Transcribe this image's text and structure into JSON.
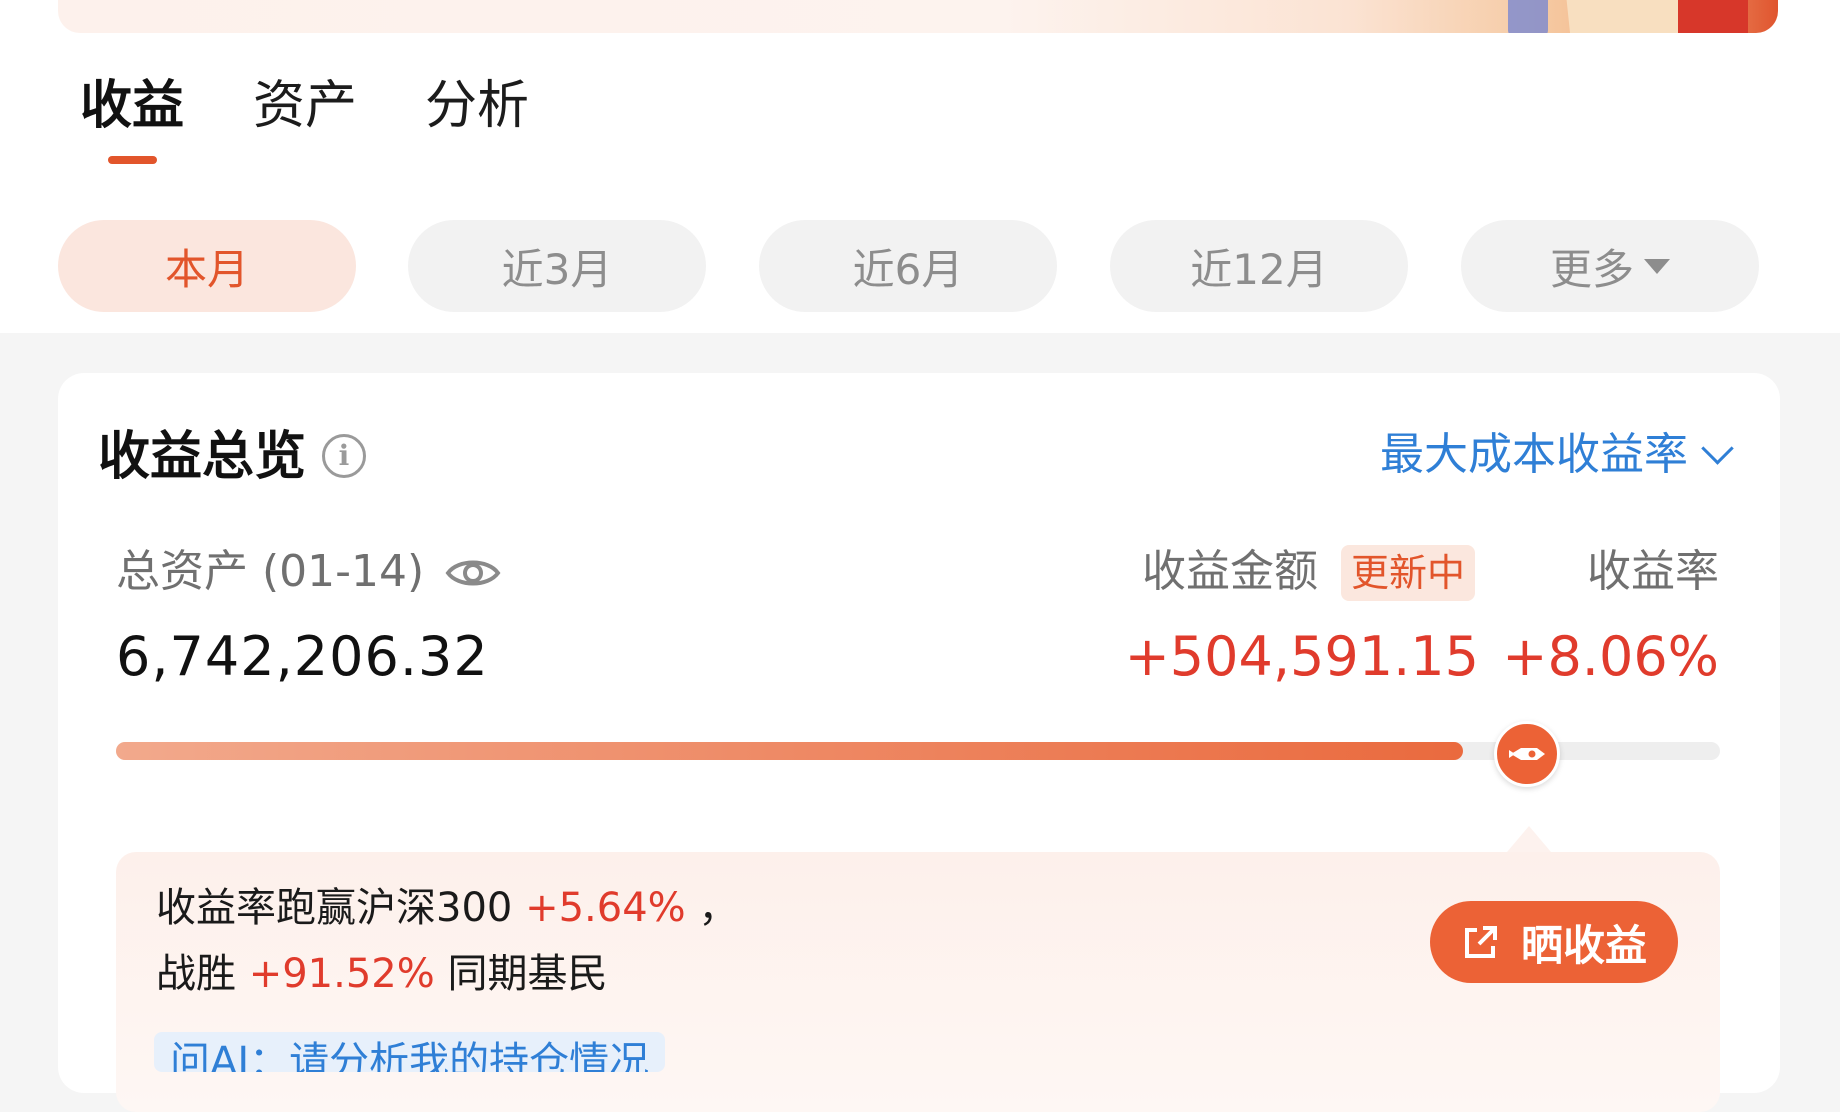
{
  "tabs": [
    {
      "label": "收益",
      "active": true
    },
    {
      "label": "资产",
      "active": false
    },
    {
      "label": "分析",
      "active": false
    }
  ],
  "periods": [
    {
      "label": "本月",
      "active": true
    },
    {
      "label": "近3月",
      "active": false
    },
    {
      "label": "近6月",
      "active": false
    },
    {
      "label": "近12月",
      "active": false
    },
    {
      "label": "更多",
      "active": false
    }
  ],
  "overview": {
    "title": "收益总览",
    "info_icon": "info-icon",
    "metric_selector": "最大成本收益率",
    "assets_label": "总资产 (01-14)",
    "assets_value": "6,742,206.32",
    "earnings_label": "收益金额",
    "updating_badge": "更新中",
    "rate_label": "收益率",
    "earnings_value": "+504,591.15",
    "rate_value": "+8.06%",
    "progress_fraction": 0.84
  },
  "tip": {
    "line1_prefix": "收益率跑赢沪深300 ",
    "line1_value": "+5.64%",
    "line1_suffix": " ，",
    "line2_prefix": "战胜 ",
    "line2_value": "+91.52%",
    "line2_suffix": " 同期基民",
    "share_button": "晒收益",
    "ai_prompt": "问AI：请分析我的持仓情况"
  },
  "colors": {
    "accent": "#e2552b",
    "positive": "#e03b2c",
    "link": "#2f7fd6",
    "muted": "#8d8d8d"
  }
}
